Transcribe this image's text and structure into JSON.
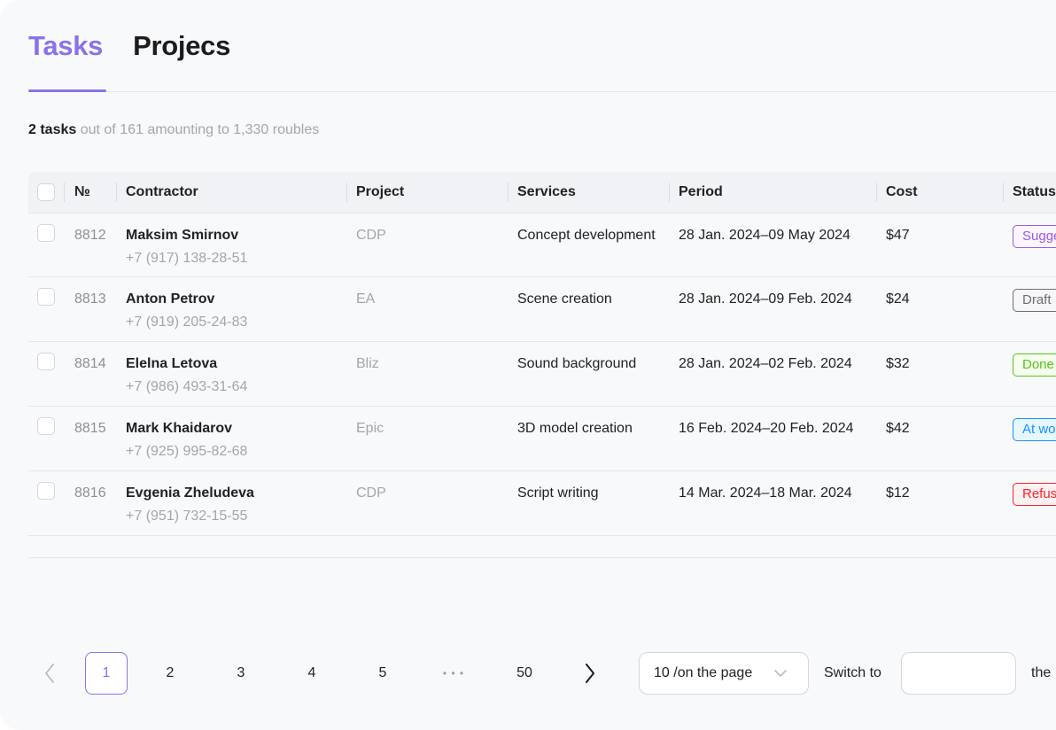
{
  "tabs": [
    {
      "label": "Tasks",
      "active": true
    },
    {
      "label": "Projecs",
      "active": false
    }
  ],
  "summary": {
    "count": "2 tasks",
    "rest": " out of 161 amounting to 1,330 roubles"
  },
  "table": {
    "columns": {
      "number": "№",
      "contractor": "Contractor",
      "project": "Project",
      "services": "Services",
      "period": "Period",
      "cost": "Cost",
      "status": "Status"
    },
    "rows": [
      {
        "number": "8812",
        "name": "Maksim Smirnov",
        "phone": "+7 (917) 138-28-51",
        "project": "CDP",
        "services": "Concept development",
        "period": "28 Jan. 2024–09 May 2024",
        "cost": "$47",
        "status": "Suggested",
        "status_color": "#9b59e6",
        "status_bg": "#faf5ff"
      },
      {
        "number": "8813",
        "name": "Anton Petrov",
        "phone": "+7 (919) 205-24-83",
        "project": "EA",
        "services": "Scene creation",
        "period": "28 Jan. 2024–09 Feb. 2024",
        "cost": "$24",
        "status": "Draft",
        "status_color": "#6b6e75",
        "status_bg": "#f6f6f8"
      },
      {
        "number": "8814",
        "name": "Elelna Letova",
        "phone": "+7 (986) 493-31-64",
        "project": "Bliz",
        "services": "Sound background",
        "period": "28 Jan. 2024–02 Feb. 2024",
        "cost": "$32",
        "status": "Done",
        "status_color": "#52c41a",
        "status_bg": "#f6ffed"
      },
      {
        "number": "8815",
        "name": "Mark Khaidarov",
        "phone": "+7 (925) 995-82-68",
        "project": "Epic",
        "services": "3D model creation",
        "period": "16 Feb. 2024–20 Feb. 2024",
        "cost": "$42",
        "status": "At work",
        "status_color": "#1890ff",
        "status_bg": "#e6f7ff"
      },
      {
        "number": "8816",
        "name": "Evgenia Zheludeva",
        "phone": "+7 (951) 732-15-55",
        "project": "CDP",
        "services": "Script writing",
        "period": "14 Mar. 2024–18 Mar. 2024",
        "cost": "$12",
        "status": "Refused",
        "status_color": "#f5222d",
        "status_bg": "#fff1f0"
      }
    ]
  },
  "pagination": {
    "prev_icon": "chevron-left-icon",
    "next_icon": "chevron-right-icon",
    "pages": [
      "1",
      "2",
      "3",
      "4",
      "5"
    ],
    "ellipsis": "• • •",
    "last_page": "50",
    "current": "1",
    "per_page": "10 /on the page",
    "switch_label": "Switch to",
    "switch_value": "",
    "suffix": "the"
  },
  "colors": {
    "accent": "#8a73e8"
  }
}
